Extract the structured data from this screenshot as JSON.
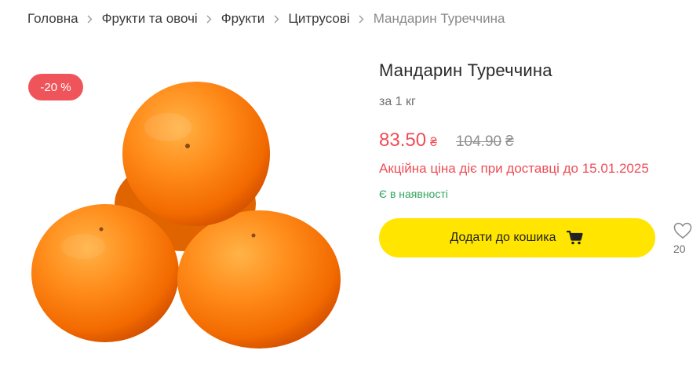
{
  "breadcrumb": {
    "items": [
      {
        "label": "Головна"
      },
      {
        "label": "Фрукти та овочі"
      },
      {
        "label": "Фрукти"
      },
      {
        "label": "Цитрусові"
      }
    ],
    "current": "Мандарин Туреччина"
  },
  "product": {
    "discount_badge": "-20 %",
    "title": "Мандарин Туреччина",
    "unit": "за 1 кг",
    "price": "83.50",
    "currency": "₴",
    "old_price": "104.90",
    "promo_text": "Акційна ціна діє при доставці до 15.01.2025",
    "stock_text": "Є в наявності",
    "add_to_cart_label": "Додати до кошика",
    "favorites_count": "20"
  },
  "icons": {
    "breadcrumb_separator": "chevron-right-icon",
    "cart": "cart-icon",
    "favorite": "heart-icon"
  },
  "colors": {
    "discount": "#f0545b",
    "price": "#ef4d56",
    "stock": "#2fa55a",
    "button": "#ffe500"
  }
}
